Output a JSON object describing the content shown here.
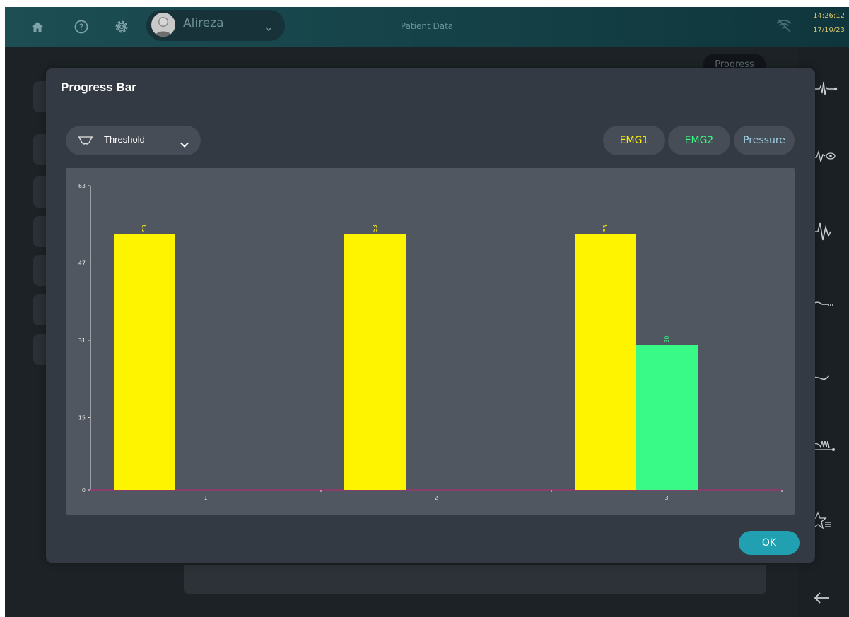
{
  "topbar": {
    "user_name": "Alireza",
    "page_title": "Patient Data",
    "time": "14:26:12",
    "date": "17/10/23"
  },
  "background": {
    "progress_chip": "Progress"
  },
  "dialog": {
    "title": "Progress Bar",
    "dropdown_label": "Threshold",
    "chips": [
      "EMG1",
      "EMG2",
      "Pressure"
    ],
    "ok_label": "OK"
  },
  "colors": {
    "emg1": "#fff400",
    "emg2": "#39fa86",
    "pressure": "#9ccfe3",
    "axis_baseline": "#c0257a"
  },
  "chart_data": {
    "type": "bar",
    "categories": [
      "1",
      "2",
      "3"
    ],
    "series": [
      {
        "name": "EMG1",
        "values": [
          53,
          53,
          53
        ]
      },
      {
        "name": "EMG2",
        "values": [
          null,
          null,
          30
        ]
      }
    ],
    "ylim": [
      0,
      63
    ],
    "yticks": [
      0,
      15,
      31,
      47,
      63
    ],
    "data_labels": true
  }
}
